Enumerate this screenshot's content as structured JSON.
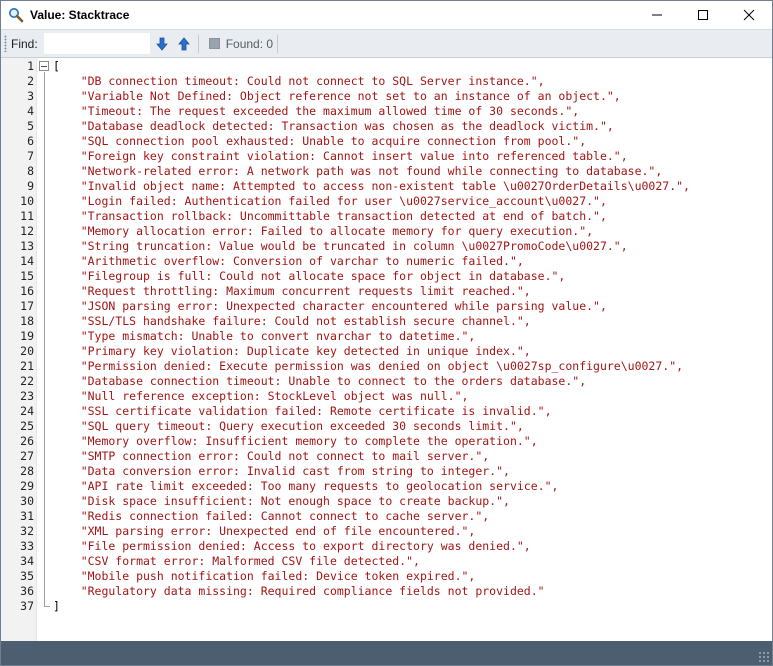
{
  "window": {
    "title": "Value: Stacktrace",
    "icons": {
      "app": "magnifier-icon",
      "minimize": "minimize-icon",
      "maximize": "maximize-icon",
      "close": "close-icon"
    }
  },
  "toolbar": {
    "find_label": "Find:",
    "find_value": "",
    "find_next_icon": "arrow-down-icon",
    "find_prev_icon": "arrow-up-icon",
    "found_label": "Found: 0"
  },
  "editor": {
    "lines": [
      {
        "num": "1",
        "text": "["
      },
      {
        "num": "2",
        "text": "    \"DB connection timeout: Could not connect to SQL Server instance.\","
      },
      {
        "num": "3",
        "text": "    \"Variable Not Defined: Object reference not set to an instance of an object.\","
      },
      {
        "num": "4",
        "text": "    \"Timeout: The request exceeded the maximum allowed time of 30 seconds.\","
      },
      {
        "num": "5",
        "text": "    \"Database deadlock detected: Transaction was chosen as the deadlock victim.\","
      },
      {
        "num": "6",
        "text": "    \"SQL connection pool exhausted: Unable to acquire connection from pool.\","
      },
      {
        "num": "7",
        "text": "    \"Foreign key constraint violation: Cannot insert value into referenced table.\","
      },
      {
        "num": "8",
        "text": "    \"Network-related error: A network path was not found while connecting to database.\","
      },
      {
        "num": "9",
        "text": "    \"Invalid object name: Attempted to access non-existent table \\u0027OrderDetails\\u0027.\","
      },
      {
        "num": "10",
        "text": "    \"Login failed: Authentication failed for user \\u0027service_account\\u0027.\","
      },
      {
        "num": "11",
        "text": "    \"Transaction rollback: Uncommittable transaction detected at end of batch.\","
      },
      {
        "num": "12",
        "text": "    \"Memory allocation error: Failed to allocate memory for query execution.\","
      },
      {
        "num": "13",
        "text": "    \"String truncation: Value would be truncated in column \\u0027PromoCode\\u0027.\","
      },
      {
        "num": "14",
        "text": "    \"Arithmetic overflow: Conversion of varchar to numeric failed.\","
      },
      {
        "num": "15",
        "text": "    \"Filegroup is full: Could not allocate space for object in database.\","
      },
      {
        "num": "16",
        "text": "    \"Request throttling: Maximum concurrent requests limit reached.\","
      },
      {
        "num": "17",
        "text": "    \"JSON parsing error: Unexpected character encountered while parsing value.\","
      },
      {
        "num": "18",
        "text": "    \"SSL/TLS handshake failure: Could not establish secure channel.\","
      },
      {
        "num": "19",
        "text": "    \"Type mismatch: Unable to convert nvarchar to datetime.\","
      },
      {
        "num": "20",
        "text": "    \"Primary key violation: Duplicate key detected in unique index.\","
      },
      {
        "num": "21",
        "text": "    \"Permission denied: Execute permission was denied on object \\u0027sp_configure\\u0027.\","
      },
      {
        "num": "22",
        "text": "    \"Database connection timeout: Unable to connect to the orders database.\","
      },
      {
        "num": "23",
        "text": "    \"Null reference exception: StockLevel object was null.\","
      },
      {
        "num": "24",
        "text": "    \"SSL certificate validation failed: Remote certificate is invalid.\","
      },
      {
        "num": "25",
        "text": "    \"SQL query timeout: Query execution exceeded 30 seconds limit.\","
      },
      {
        "num": "26",
        "text": "    \"Memory overflow: Insufficient memory to complete the operation.\","
      },
      {
        "num": "27",
        "text": "    \"SMTP connection error: Could not connect to mail server.\","
      },
      {
        "num": "28",
        "text": "    \"Data conversion error: Invalid cast from string to integer.\","
      },
      {
        "num": "29",
        "text": "    \"API rate limit exceeded: Too many requests to geolocation service.\","
      },
      {
        "num": "30",
        "text": "    \"Disk space insufficient: Not enough space to create backup.\","
      },
      {
        "num": "31",
        "text": "    \"Redis connection failed: Cannot connect to cache server.\","
      },
      {
        "num": "32",
        "text": "    \"XML parsing error: Unexpected end of file encountered.\","
      },
      {
        "num": "33",
        "text": "    \"File permission denied: Access to export directory was denied.\","
      },
      {
        "num": "34",
        "text": "    \"CSV format error: Malformed CSV file detected.\","
      },
      {
        "num": "35",
        "text": "    \"Mobile push notification failed: Device token expired.\","
      },
      {
        "num": "36",
        "text": "    \"Regulatory data missing: Required compliance fields not provided.\""
      },
      {
        "num": "37",
        "text": "]"
      }
    ]
  },
  "colors": {
    "string": "#a31515",
    "statusbar": "#4c5e70",
    "toolbar": "#e9ecf0",
    "find_arrow": "#2a6fcf"
  }
}
